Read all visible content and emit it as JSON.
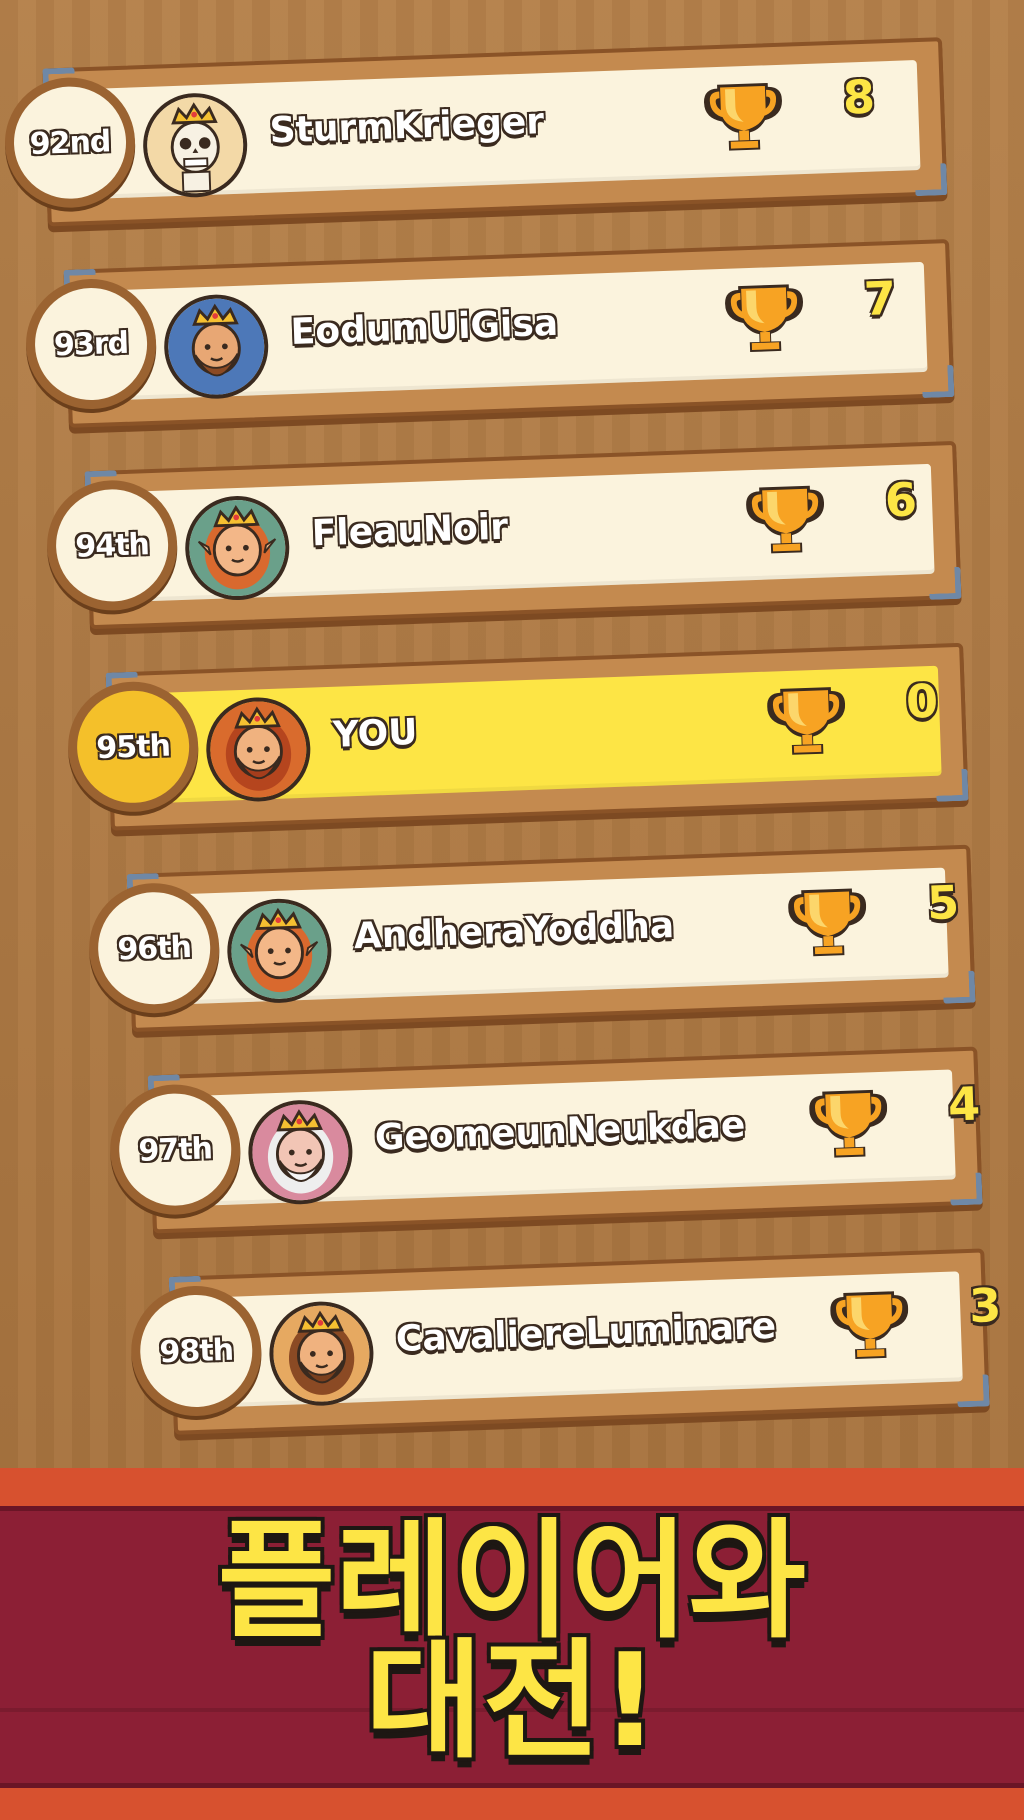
{
  "leaderboard": {
    "rows": [
      {
        "rank": "92nd",
        "name": "SturmKrieger",
        "score": "8",
        "avatar": "skeleton-king-avatar",
        "you": false
      },
      {
        "rank": "93rd",
        "name": "EodumUiGisa",
        "score": "7",
        "avatar": "bald-bearded-king-avatar",
        "you": false
      },
      {
        "rank": "94th",
        "name": "FleauNoir",
        "score": "6",
        "avatar": "elf-princess-avatar",
        "you": false
      },
      {
        "rank": "95th",
        "name": "YOU",
        "score": "0",
        "avatar": "red-bearded-king-avatar",
        "you": true
      },
      {
        "rank": "96th",
        "name": "AndheraYoddha",
        "score": "5",
        "avatar": "elf-princess-avatar",
        "you": false
      },
      {
        "rank": "97th",
        "name": "GeomeunNeukdae",
        "score": "4",
        "avatar": "old-wizard-king-avatar",
        "you": false
      },
      {
        "rank": "98th",
        "name": "CavaliereLuminare",
        "score": "3",
        "avatar": "mustache-king-avatar",
        "you": false
      }
    ]
  },
  "banner": {
    "line1": "플레이어와",
    "line2": "대전!"
  },
  "colors": {
    "highlight": "#fde545",
    "panel": "#fbf3dd",
    "wood": "#c48a4f",
    "banner": "#8c1f35",
    "banner_edge": "#d7512f",
    "score_text": "#fde545"
  }
}
